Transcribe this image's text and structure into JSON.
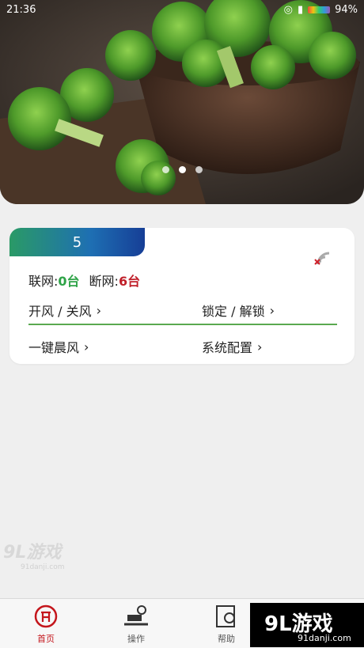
{
  "status_bar": {
    "time": "21:36",
    "battery": "94%"
  },
  "banner": {
    "dots": [
      "",
      "",
      ""
    ],
    "active_dot": 1
  },
  "device_card": {
    "group_number": "5",
    "online_label": "联网:",
    "online_count": "0台",
    "offline_label": "断网:",
    "offline_count": "6台",
    "actions": {
      "fan_toggle": "开风 / 关风",
      "lock_toggle": "锁定 / 解锁",
      "morning_wind": "一键晨风",
      "system_config": "系统配置"
    },
    "colors": {
      "online": "#2ea347",
      "offline": "#c0202a",
      "divider": "#5aa950"
    }
  },
  "bottom_nav": {
    "items": [
      {
        "label": "首页",
        "icon": "home-icon",
        "active": true
      },
      {
        "label": "操作",
        "icon": "operation-icon",
        "active": false
      },
      {
        "label": "帮助",
        "icon": "help-icon",
        "active": false
      }
    ],
    "active_color": "#c4161c"
  },
  "watermark": {
    "brand": "9L游戏",
    "site": "91danji.com"
  }
}
